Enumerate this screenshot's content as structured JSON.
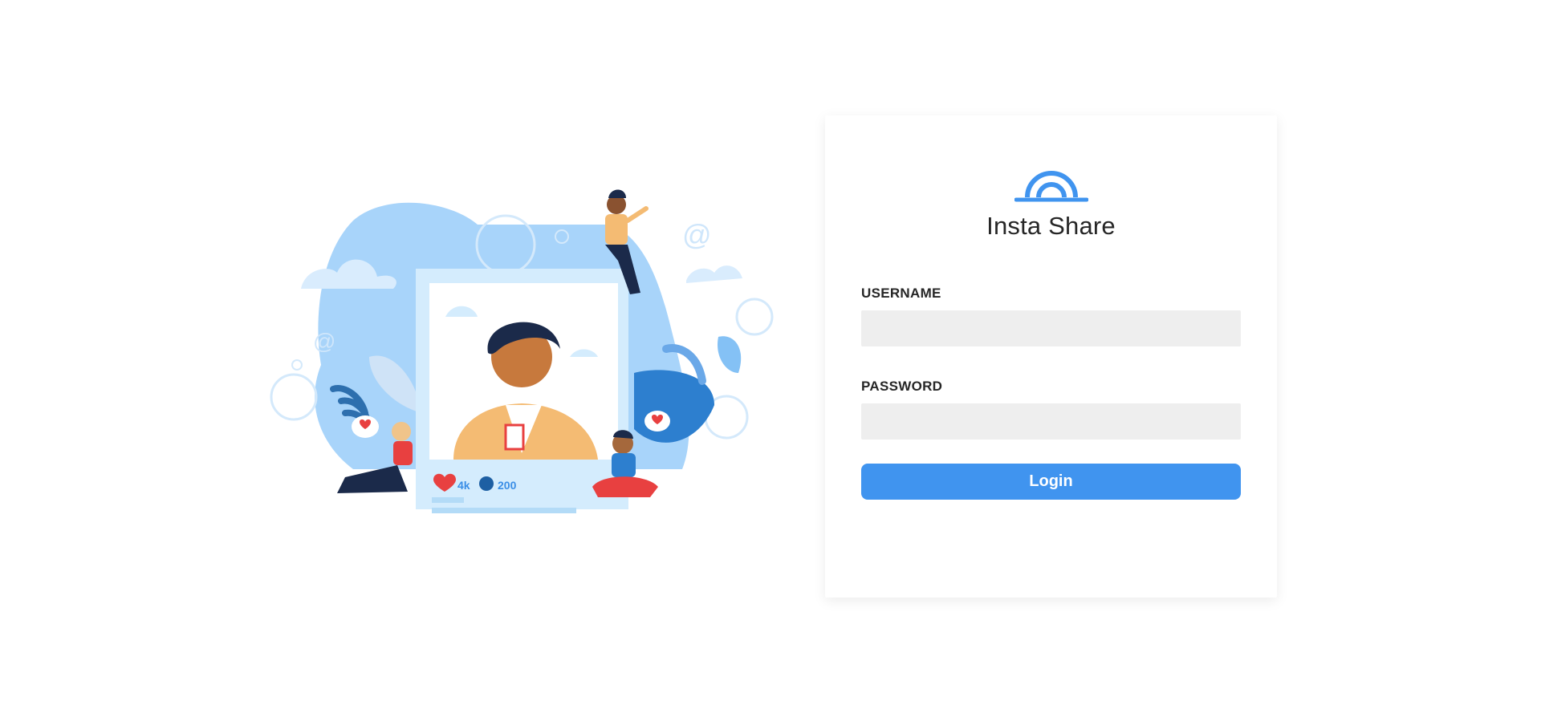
{
  "brand": {
    "name": "Insta Share",
    "accent_color": "#4094ef",
    "logo_icon": "rainbow-logo-icon"
  },
  "login_form": {
    "username_label": "USERNAME",
    "username_value": "",
    "password_label": "PASSWORD",
    "password_value": "",
    "login_button_label": "Login"
  },
  "illustration": {
    "likes_count": "4k",
    "comments_count": "200",
    "like_icon": "heart-icon",
    "comment_icon": "comment-bubble-icon"
  }
}
